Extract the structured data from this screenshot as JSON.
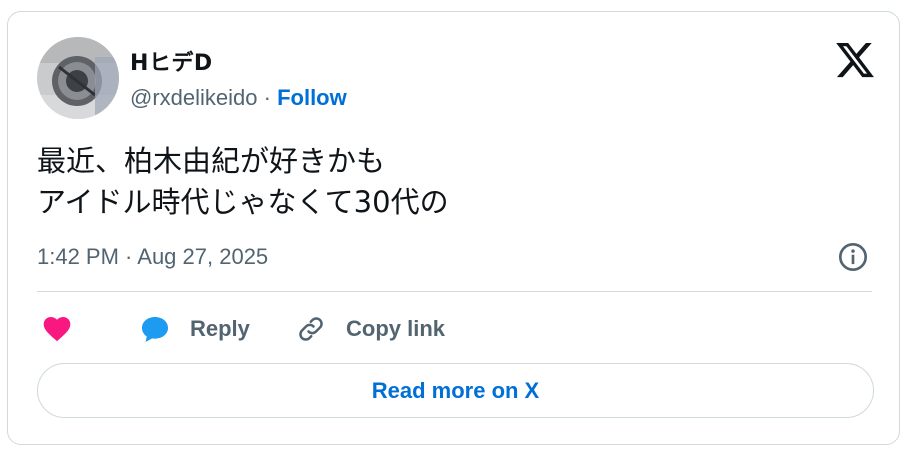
{
  "author": {
    "display_name": "HヒデD",
    "handle": "@rxdelikeido",
    "separator": "·",
    "follow_label": "Follow"
  },
  "tweet": {
    "line1": "最近、柏木由紀が好きかも",
    "line2": "アイドル時代じゃなくて30代の",
    "timestamp": "1:42 PM · Aug 27, 2025"
  },
  "actions": {
    "like_icon": "heart-icon",
    "reply_label": "Reply",
    "copy_link_label": "Copy link"
  },
  "read_more_label": "Read more on X",
  "colors": {
    "link": "#006fd6",
    "muted": "#536471",
    "heart": "#f91880",
    "reply_icon": "#1d9bf0",
    "border": "#cfd9de"
  }
}
